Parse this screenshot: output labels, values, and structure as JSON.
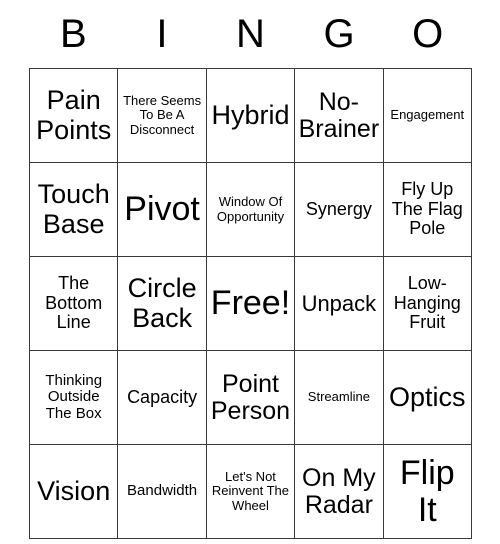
{
  "header": {
    "letters": [
      "B",
      "I",
      "N",
      "G",
      "O"
    ]
  },
  "grid": {
    "rows": [
      [
        {
          "text": "Pain Points",
          "size": "fs-xl"
        },
        {
          "text": "There Seems To Be A Disconnect",
          "size": "fs-xxs"
        },
        {
          "text": "Hybrid",
          "size": "fs-xl"
        },
        {
          "text": "No-Brainer",
          "size": "fs-lg"
        },
        {
          "text": "Engagement",
          "size": "fs-xxs"
        }
      ],
      [
        {
          "text": "Touch Base",
          "size": "fs-xl"
        },
        {
          "text": "Pivot",
          "size": "fs-xxl"
        },
        {
          "text": "Window Of Opportunity",
          "size": "fs-xxs"
        },
        {
          "text": "Synergy",
          "size": "fs-sm"
        },
        {
          "text": "Fly Up The Flag Pole",
          "size": "fs-sm"
        }
      ],
      [
        {
          "text": "The Bottom Line",
          "size": "fs-sm"
        },
        {
          "text": "Circle Back",
          "size": "fs-xl"
        },
        {
          "text": "Free!",
          "size": "fs-xxl"
        },
        {
          "text": "Unpack",
          "size": "fs-md"
        },
        {
          "text": "Low-Hanging Fruit",
          "size": "fs-sm"
        }
      ],
      [
        {
          "text": "Thinking Outside The Box",
          "size": "fs-xs"
        },
        {
          "text": "Capacity",
          "size": "fs-sm"
        },
        {
          "text": "Point Person",
          "size": "fs-lg"
        },
        {
          "text": "Streamline",
          "size": "fs-xxs"
        },
        {
          "text": "Optics",
          "size": "fs-xl"
        }
      ],
      [
        {
          "text": "Vision",
          "size": "fs-xl"
        },
        {
          "text": "Bandwidth",
          "size": "fs-xs"
        },
        {
          "text": "Let's Not Reinvent The Wheel",
          "size": "fs-xxs"
        },
        {
          "text": "On My Radar",
          "size": "fs-lg"
        },
        {
          "text": "Flip It",
          "size": "fs-xxl"
        }
      ]
    ]
  },
  "colors": {
    "background": "#ffffff",
    "border": "#3a3a3a",
    "text": "#000000"
  }
}
